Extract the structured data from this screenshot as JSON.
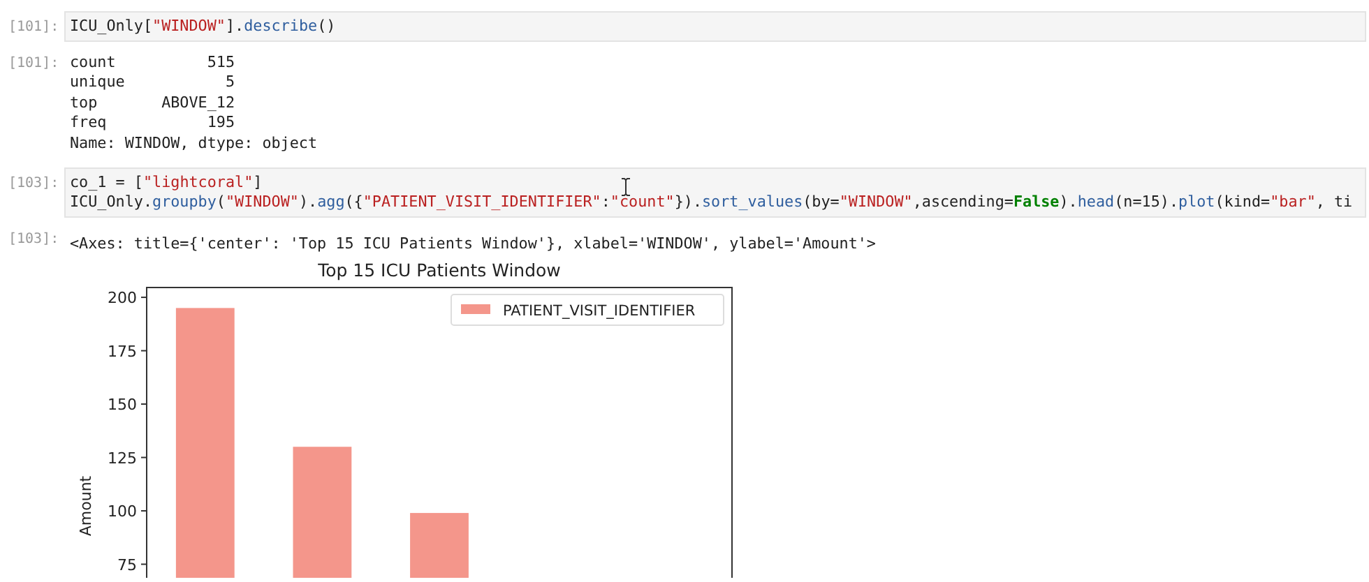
{
  "cells": [
    {
      "prompt": "[101]:",
      "code": [
        [
          {
            "kind": "plain",
            "text": "ICU_Only["
          },
          {
            "kind": "string",
            "text": "\"WINDOW\""
          },
          {
            "kind": "plain",
            "text": "]."
          },
          {
            "kind": "method",
            "text": "describe"
          },
          {
            "kind": "plain",
            "text": "()"
          }
        ]
      ],
      "output_prompt": "[101]:",
      "output": [
        "count          515",
        "unique           5",
        "top       ABOVE_12",
        "freq           195",
        "Name: WINDOW, dtype: object"
      ]
    },
    {
      "prompt": "[103]:",
      "code": [
        [
          {
            "kind": "plain",
            "text": "co_1 = ["
          },
          {
            "kind": "string",
            "text": "\"lightcoral\""
          },
          {
            "kind": "plain",
            "text": "]"
          }
        ],
        [
          {
            "kind": "plain",
            "text": "ICU_Only."
          },
          {
            "kind": "method",
            "text": "groupby"
          },
          {
            "kind": "plain",
            "text": "("
          },
          {
            "kind": "string",
            "text": "\"WINDOW\""
          },
          {
            "kind": "plain",
            "text": ")."
          },
          {
            "kind": "method",
            "text": "agg"
          },
          {
            "kind": "plain",
            "text": "({"
          },
          {
            "kind": "string",
            "text": "\"PATIENT_VISIT_IDENTIFIER\""
          },
          {
            "kind": "plain",
            "text": ":"
          },
          {
            "kind": "string",
            "text": "\"count\""
          },
          {
            "kind": "plain",
            "text": "})."
          },
          {
            "kind": "method",
            "text": "sort_values"
          },
          {
            "kind": "plain",
            "text": "(by="
          },
          {
            "kind": "string",
            "text": "\"WINDOW\""
          },
          {
            "kind": "plain",
            "text": ",ascending="
          },
          {
            "kind": "keyword",
            "text": "False"
          },
          {
            "kind": "plain",
            "text": ")."
          },
          {
            "kind": "method",
            "text": "head"
          },
          {
            "kind": "plain",
            "text": "(n=15)."
          },
          {
            "kind": "method",
            "text": "plot"
          },
          {
            "kind": "plain",
            "text": "(kind="
          },
          {
            "kind": "string",
            "text": "\"bar\""
          },
          {
            "kind": "plain",
            "text": ", ti"
          }
        ]
      ],
      "output_prompt": "[103]:",
      "output": [
        "<Axes: title={'center': 'Top 15 ICU Patients Window'}, xlabel='WINDOW', ylabel='Amount'>"
      ],
      "chart_data": {
        "type": "bar",
        "title": "Top 15 ICU Patients Window",
        "ylabel": "Amount",
        "ylim": [
          0,
          204.6
        ],
        "yticks": [
          75,
          100,
          125,
          150,
          175,
          200
        ],
        "series": [
          {
            "name": "PATIENT_VISIT_IDENTIFIER",
            "color": "#f4968b",
            "values": [
              195,
              130,
              99
            ]
          }
        ]
      }
    }
  ]
}
